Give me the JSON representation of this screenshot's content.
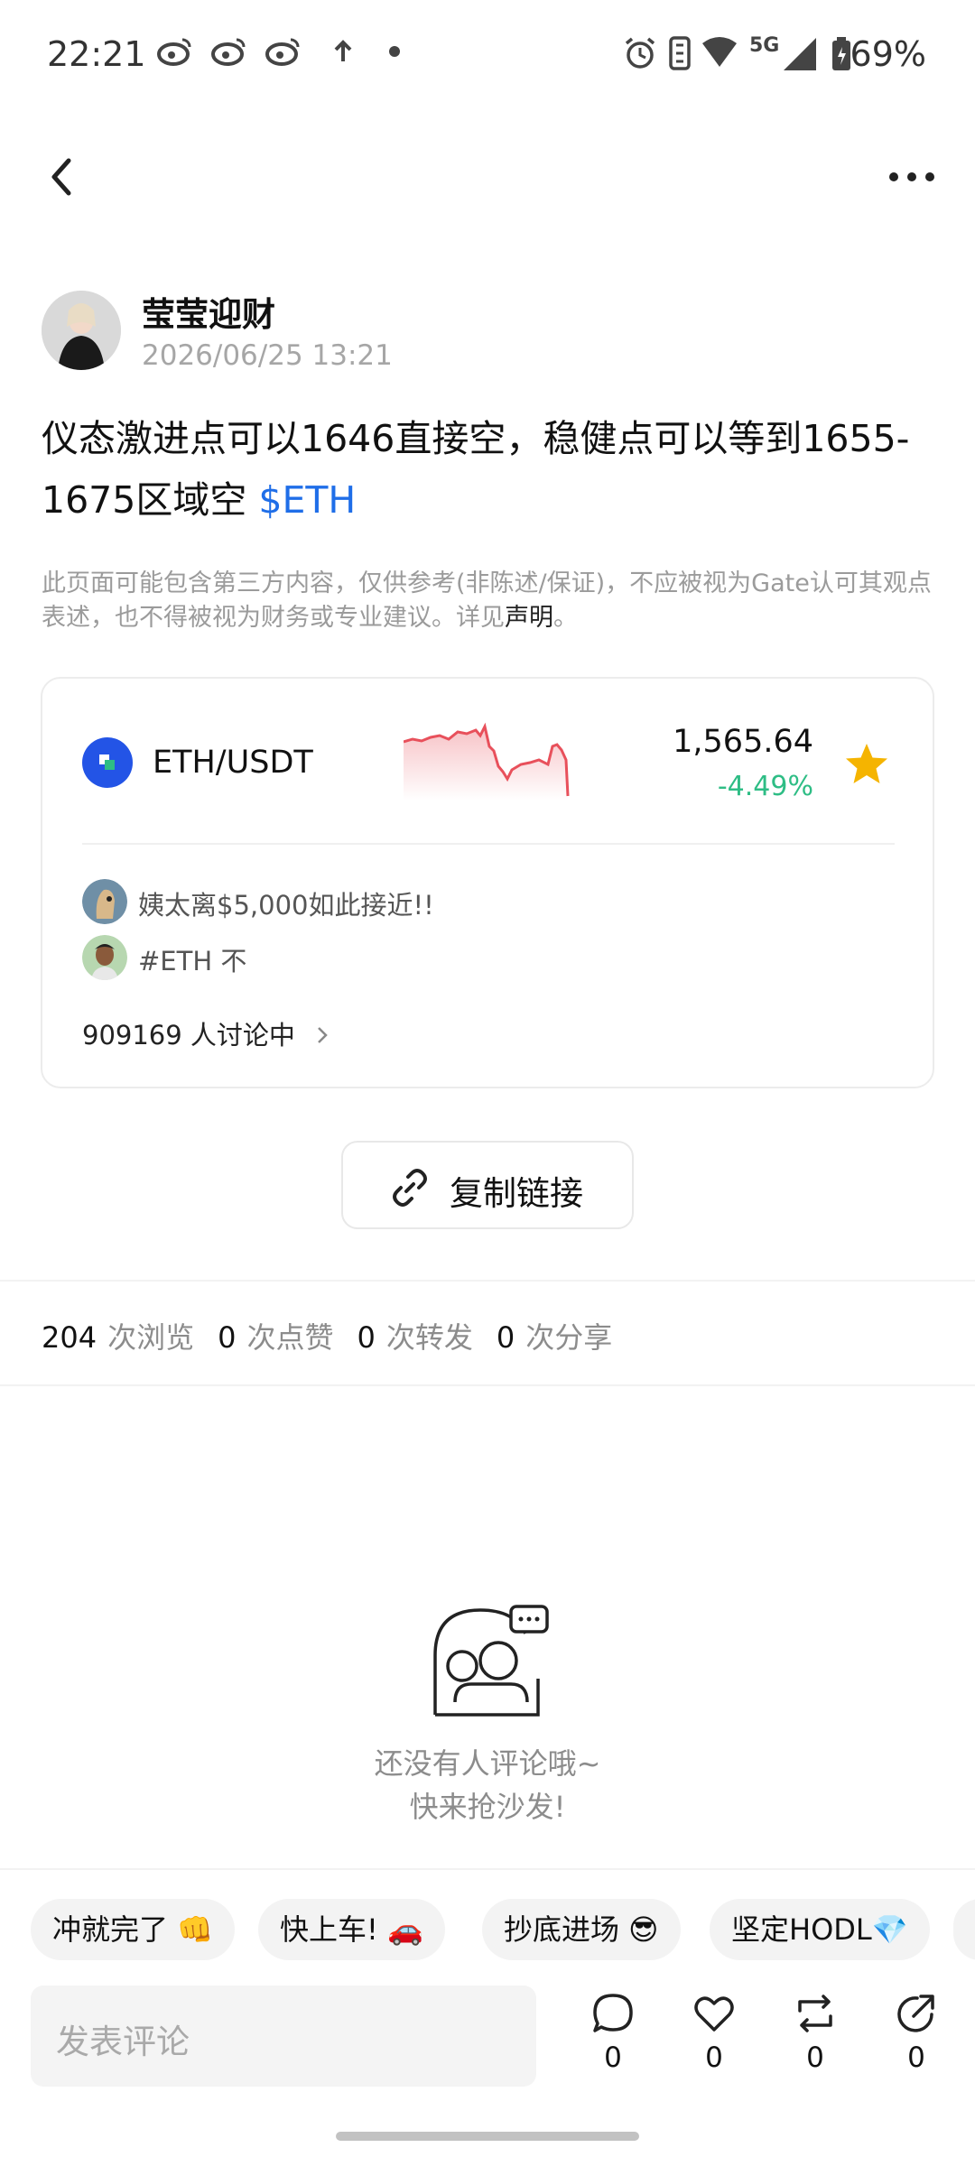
{
  "status_bar": {
    "time": "22:21",
    "battery": "69%",
    "network": "5G"
  },
  "nav": {
    "back_icon": "back-arrow-icon",
    "more_icon": "more-dots-icon"
  },
  "post": {
    "author": "莹莹迎财",
    "time": "2026/06/25 13:21",
    "text": "仪态激进点可以1646直接空，稳健点可以等到1655-1675区域空",
    "tag": "$ETH",
    "disclaimer": "此页面可能包含第三方内容，仅供参考(非陈述/保证)，不应被视为Gate认可其观点表述，也不得被视为财务或专业建议。详见",
    "disclaimer_link": "声明",
    "disclaimer_end": "。"
  },
  "market_card": {
    "pair": "ETH/USDT",
    "price": "1,565.64",
    "change": "-4.49%",
    "change_color": "#2ebd85",
    "spark_color": "#e8505b",
    "discussion": [
      {
        "text": "姨太离$5,000如此接近!!"
      },
      {
        "text": "#ETH 不"
      }
    ],
    "discussing": "909169 人讨论中"
  },
  "copy_link": {
    "label": "复制链接"
  },
  "stats": {
    "views": "204",
    "views_label": "次浏览",
    "likes": "0",
    "likes_label": "次点赞",
    "reposts": "0",
    "reposts_label": "次转发",
    "shares": "0",
    "shares_label": "次分享"
  },
  "empty_comments": {
    "line1": "还没有人评论哦~",
    "line2": "快来抢沙发!"
  },
  "quick_replies": [
    "冲就完了 👊",
    "快上车! 🚗",
    "抄底进场 😎",
    "坚定HODL💎"
  ],
  "bottom_bar": {
    "placeholder": "发表评论",
    "comment_count": "0",
    "like_count": "0",
    "repost_count": "0",
    "share_count": "0"
  }
}
